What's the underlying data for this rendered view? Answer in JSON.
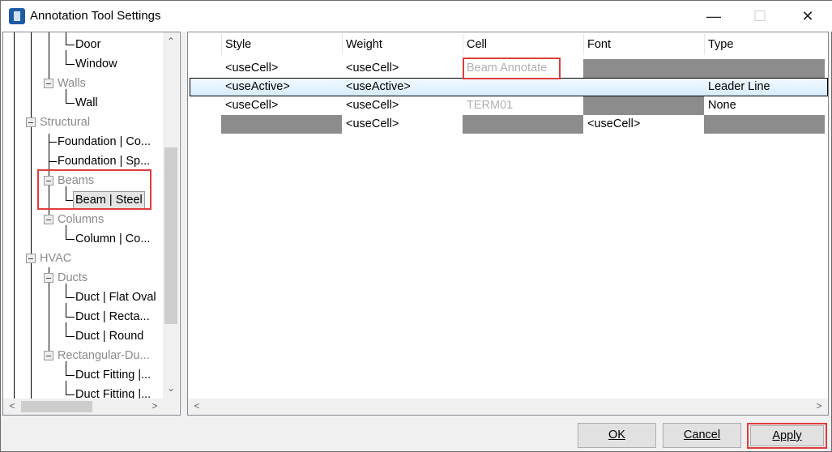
{
  "window": {
    "title": "Annotation Tool Settings",
    "minimize": "—",
    "maximize": "☐",
    "close": "✕"
  },
  "tree": {
    "items": [
      {
        "label": "Door",
        "type": "leaf"
      },
      {
        "label": "Window",
        "type": "leaf"
      },
      {
        "label": "Walls",
        "type": "group2"
      },
      {
        "label": "Wall",
        "type": "leaf"
      },
      {
        "label": "Structural",
        "type": "group1"
      },
      {
        "label": "Foundation | Co...",
        "type": "leaf2"
      },
      {
        "label": "Foundation | Sp...",
        "type": "leaf2"
      },
      {
        "label": "Beams",
        "type": "group2"
      },
      {
        "label": "Beam | Steel",
        "type": "leaf",
        "selected": true
      },
      {
        "label": "Columns",
        "type": "group2"
      },
      {
        "label": "Column | Co...",
        "type": "leaf"
      },
      {
        "label": "HVAC",
        "type": "group1"
      },
      {
        "label": "Ducts",
        "type": "group2"
      },
      {
        "label": "Duct | Flat Oval",
        "type": "leaf"
      },
      {
        "label": "Duct | Recta...",
        "type": "leaf"
      },
      {
        "label": "Duct | Round",
        "type": "leaf"
      },
      {
        "label": "Rectangular-Du...",
        "type": "group2"
      },
      {
        "label": "Duct Fitting |...",
        "type": "leaf"
      },
      {
        "label": "Duct Fitting |...",
        "type": "leaf"
      }
    ]
  },
  "grid": {
    "columns": [
      "Style",
      "Weight",
      "Cell",
      "Font",
      "Type"
    ],
    "rows": [
      [
        {
          "v": "<useCell>"
        },
        {
          "v": "<useCell>"
        },
        {
          "v": "Beam Annotate",
          "dim": true
        },
        {
          "v": "",
          "dark": true
        },
        {
          "v": "",
          "dark": true
        }
      ],
      [
        {
          "v": "<useActive>"
        },
        {
          "v": "<useActive>"
        },
        {
          "v": ""
        },
        {
          "v": ""
        },
        {
          "v": "Leader Line"
        }
      ],
      [
        {
          "v": "<useCell>"
        },
        {
          "v": "<useCell>"
        },
        {
          "v": "TERM01",
          "dim": true
        },
        {
          "v": "",
          "dark": true
        },
        {
          "v": "None"
        }
      ],
      [
        {
          "v": "",
          "dark": true
        },
        {
          "v": "<useCell>"
        },
        {
          "v": "",
          "dark": true
        },
        {
          "v": "<useCell>"
        },
        {
          "v": "",
          "dark": true
        }
      ]
    ]
  },
  "buttons": {
    "ok": "OK",
    "cancel": "Cancel",
    "apply": "Apply"
  },
  "colors": {
    "highlight": "#e03c3c",
    "dark_cell": "#8c8c8c",
    "active_row": "#d6ecfb"
  }
}
